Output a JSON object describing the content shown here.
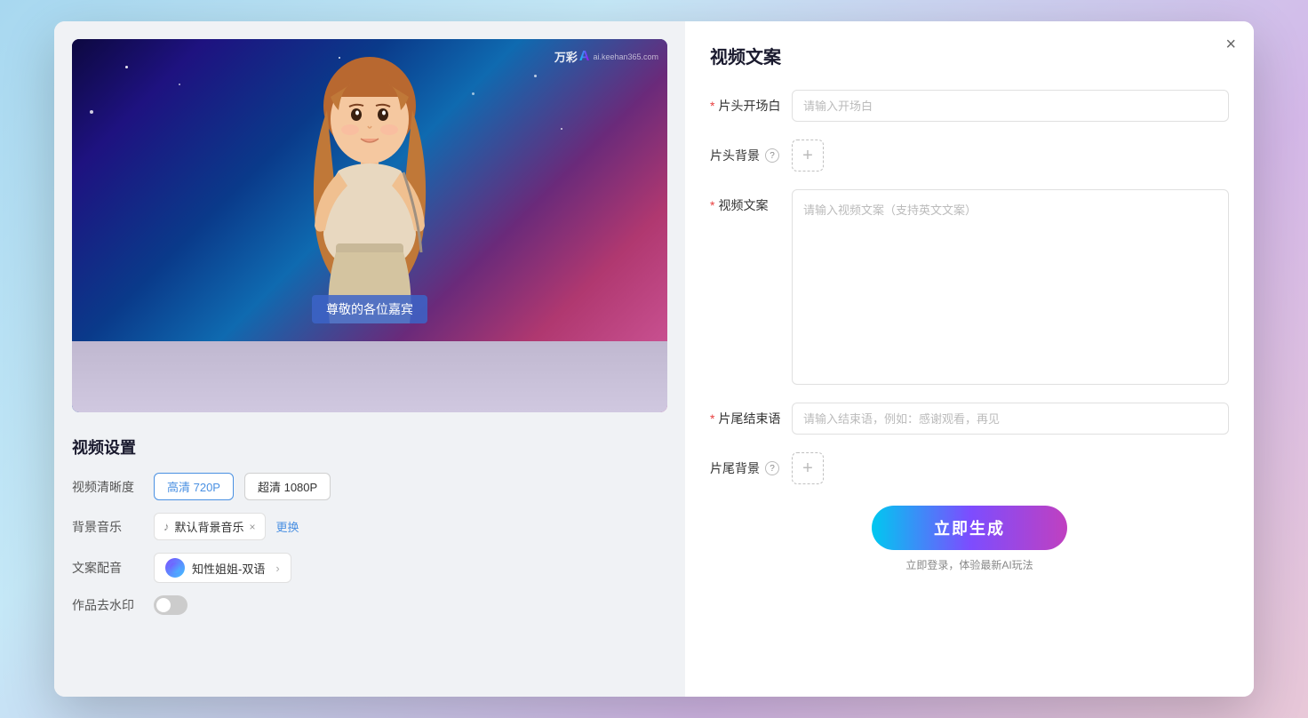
{
  "modal": {
    "close_label": "×"
  },
  "left": {
    "watermark_brand": "万彩",
    "watermark_ai": "A",
    "watermark_site": "ai.keehan365.com",
    "subtitle_text": "尊敬的各位嘉宾",
    "settings_title": "视频设置",
    "resolution_label": "视频清晰度",
    "resolution_options": [
      {
        "label": "高清 720P",
        "active": true
      },
      {
        "label": "超清 1080P",
        "active": false
      }
    ],
    "music_label": "背景音乐",
    "music_note_icon": "♪",
    "music_name": "默认背景音乐",
    "music_close_icon": "×",
    "music_change_label": "更换",
    "voice_label": "文案配音",
    "voice_name": "知性姐姐-双语",
    "voice_chevron": "›",
    "watermark_label": "作品去水印"
  },
  "right": {
    "panel_title": "视频文案",
    "intro_label": "片头开场白",
    "intro_required": "*",
    "intro_placeholder": "请输入开场白",
    "bg_label": "片头背景",
    "bg_help": "?",
    "bg_add_icon": "+",
    "copy_label": "视频文案",
    "copy_required": "*",
    "copy_placeholder": "请输入视频文案（支持英文文案）",
    "outro_label": "片尾结束语",
    "outro_required": "*",
    "outro_placeholder": "请输入结束语，例如：感谢观看，再见",
    "outro_bg_label": "片尾背景",
    "outro_bg_help": "?",
    "outro_bg_add_icon": "+",
    "generate_btn_label": "立即生成",
    "generate_note": "立即登录，体验最新AI玩法"
  }
}
